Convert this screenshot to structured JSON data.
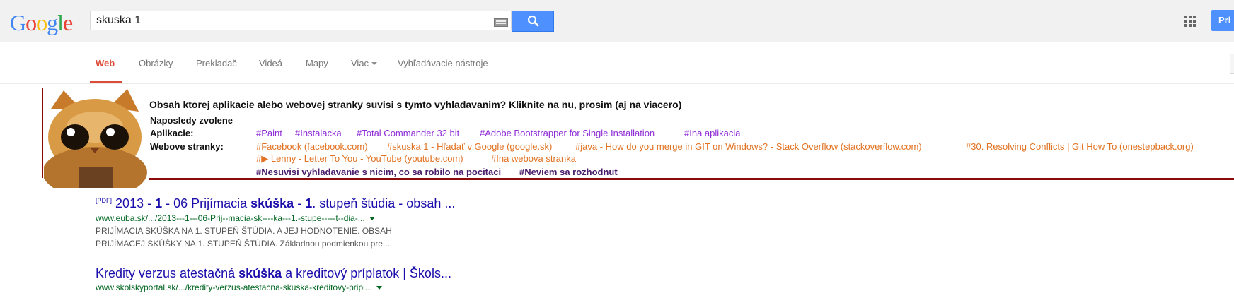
{
  "logo": {
    "text": "Google",
    "letters": [
      {
        "ch": "G",
        "color": "#4285f4"
      },
      {
        "ch": "o",
        "color": "#ea4335"
      },
      {
        "ch": "o",
        "color": "#fbbc05"
      },
      {
        "ch": "g",
        "color": "#4285f4"
      },
      {
        "ch": "l",
        "color": "#34a853"
      },
      {
        "ch": "e",
        "color": "#ea4335"
      }
    ]
  },
  "search": {
    "query": "skuska 1"
  },
  "header": {
    "signin_label": "Pri"
  },
  "tabs": [
    {
      "label": "Web",
      "active": true
    },
    {
      "label": "Obrázky"
    },
    {
      "label": "Prekladač"
    },
    {
      "label": "Videá"
    },
    {
      "label": "Mapy"
    },
    {
      "label": "Viac"
    },
    {
      "label": "Vyhľadávacie nástroje"
    }
  ],
  "panel": {
    "question": "Obsah ktorej aplikacie alebo webovej stranky suvisi s tymto vyhladavanim? Kliknite na nu, prosim (aj na viacero)",
    "recent_label": "Naposledy zvolene",
    "apps_label": "Aplikacie:",
    "apps": [
      "#Paint",
      "#Instalacka",
      "#Total Commander 32 bit",
      "#Adobe Bootstrapper for Single Installation",
      "#Ina aplikacia"
    ],
    "sites_label": "Webove stranky:",
    "sites_row1": [
      "#Facebook (facebook.com)",
      "#skuska 1 - Hľadať v Google (google.sk)",
      "#java - How do you merge in GIT on Windows? - Stack Overflow (stackoverflow.com)",
      "#30. Resolving Conflicts | Git How To (onestepback.org)"
    ],
    "sites_row2": [
      "#▶ Lenny - Letter To You - YouTube (youtube.com)",
      "#Ina webova stranka"
    ],
    "extra": [
      "#Nesuvisi vyhladavanie s nicim, co sa robilo na pocitaci",
      "#Neviem sa rozhodnut"
    ]
  },
  "results": [
    {
      "pdf_tag": "[PDF]",
      "title_parts": [
        "2013 - ",
        "1",
        " - 06 Prijímacia ",
        "skúška",
        " - ",
        "1",
        ". stupeň štúdia - obsah ..."
      ],
      "url": "www.euba.sk/.../2013---1---06-Prij--macia-sk----ka---1.-stupe-----t--dia-...",
      "snippet1": "PRIJÍMACIA SKÚŠKA NA 1. STUPEŇ ŠTÚDIA. A JEJ HODNOTENIE. OBSAH",
      "snippet2": "PRIJÍMACEJ SKÚŠKY NA 1. STUPEŇ ŠTÚDIA. Základnou podmienkou pre ..."
    },
    {
      "title_parts": [
        "Kredity verzus atestačná ",
        "skúška",
        " a kreditový príplatok | Škols..."
      ],
      "url": "www.skolskyportal.sk/.../kredity-verzus-atestacna-skuska-kreditovy-pripl..."
    }
  ]
}
